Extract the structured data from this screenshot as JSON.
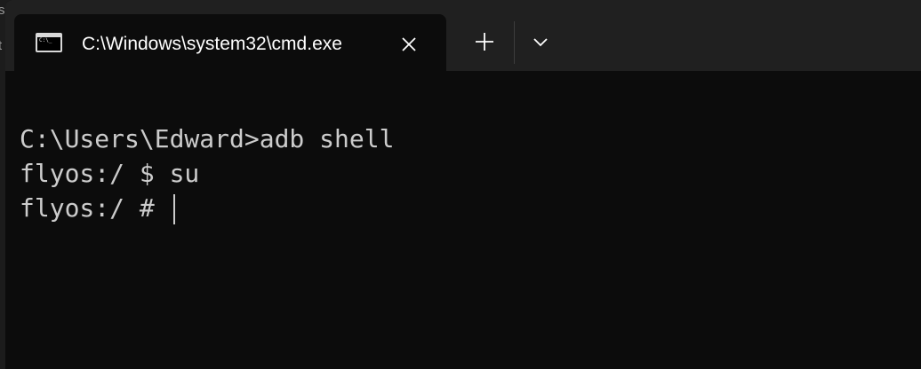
{
  "backdrop": {
    "chars": [
      "s",
      "t"
    ]
  },
  "tab": {
    "icon": "command-prompt-icon",
    "icon_glyph": "C:\\_",
    "title": "C:\\Windows\\system32\\cmd.exe",
    "close_icon": "close-icon"
  },
  "titlebar": {
    "new_tab_icon": "plus-icon",
    "dropdown_icon": "chevron-down-icon"
  },
  "terminal": {
    "lines": [
      "C:\\Users\\Edward>adb shell",
      "flyos:/ $ su",
      "flyos:/ # "
    ]
  },
  "colors": {
    "terminal_bg": "#0c0c0c",
    "titlebar_bg": "#202020",
    "text": "#cccccc"
  }
}
